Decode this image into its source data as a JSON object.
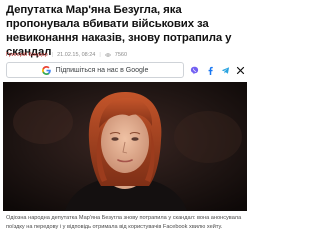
{
  "article": {
    "title": "Депутатка Мар'яна Безугла, яка пропонувала вбивати військових за невиконання наказів, знову потрапила у скандал",
    "author": "Григорій Бондар",
    "date": "21.02.15, 08:24",
    "views": "7560",
    "lead": "Одіозна народна депутатка Мар'яна Безугла знову потрапила у скандал: вона анонсувала поїздку на передову і у відповідь отримала від користувачів Facebook хвилю хейту."
  },
  "follow_button": {
    "label": "Підпишіться на нас в Google"
  },
  "share_icons": [
    "viber-icon",
    "facebook-icon",
    "telegram-icon",
    "x-icon"
  ],
  "colors": {
    "author": "#b8322e",
    "viber": "#7360f2",
    "facebook": "#1877f2",
    "telegram": "#29a3e0",
    "x": "#111111"
  }
}
